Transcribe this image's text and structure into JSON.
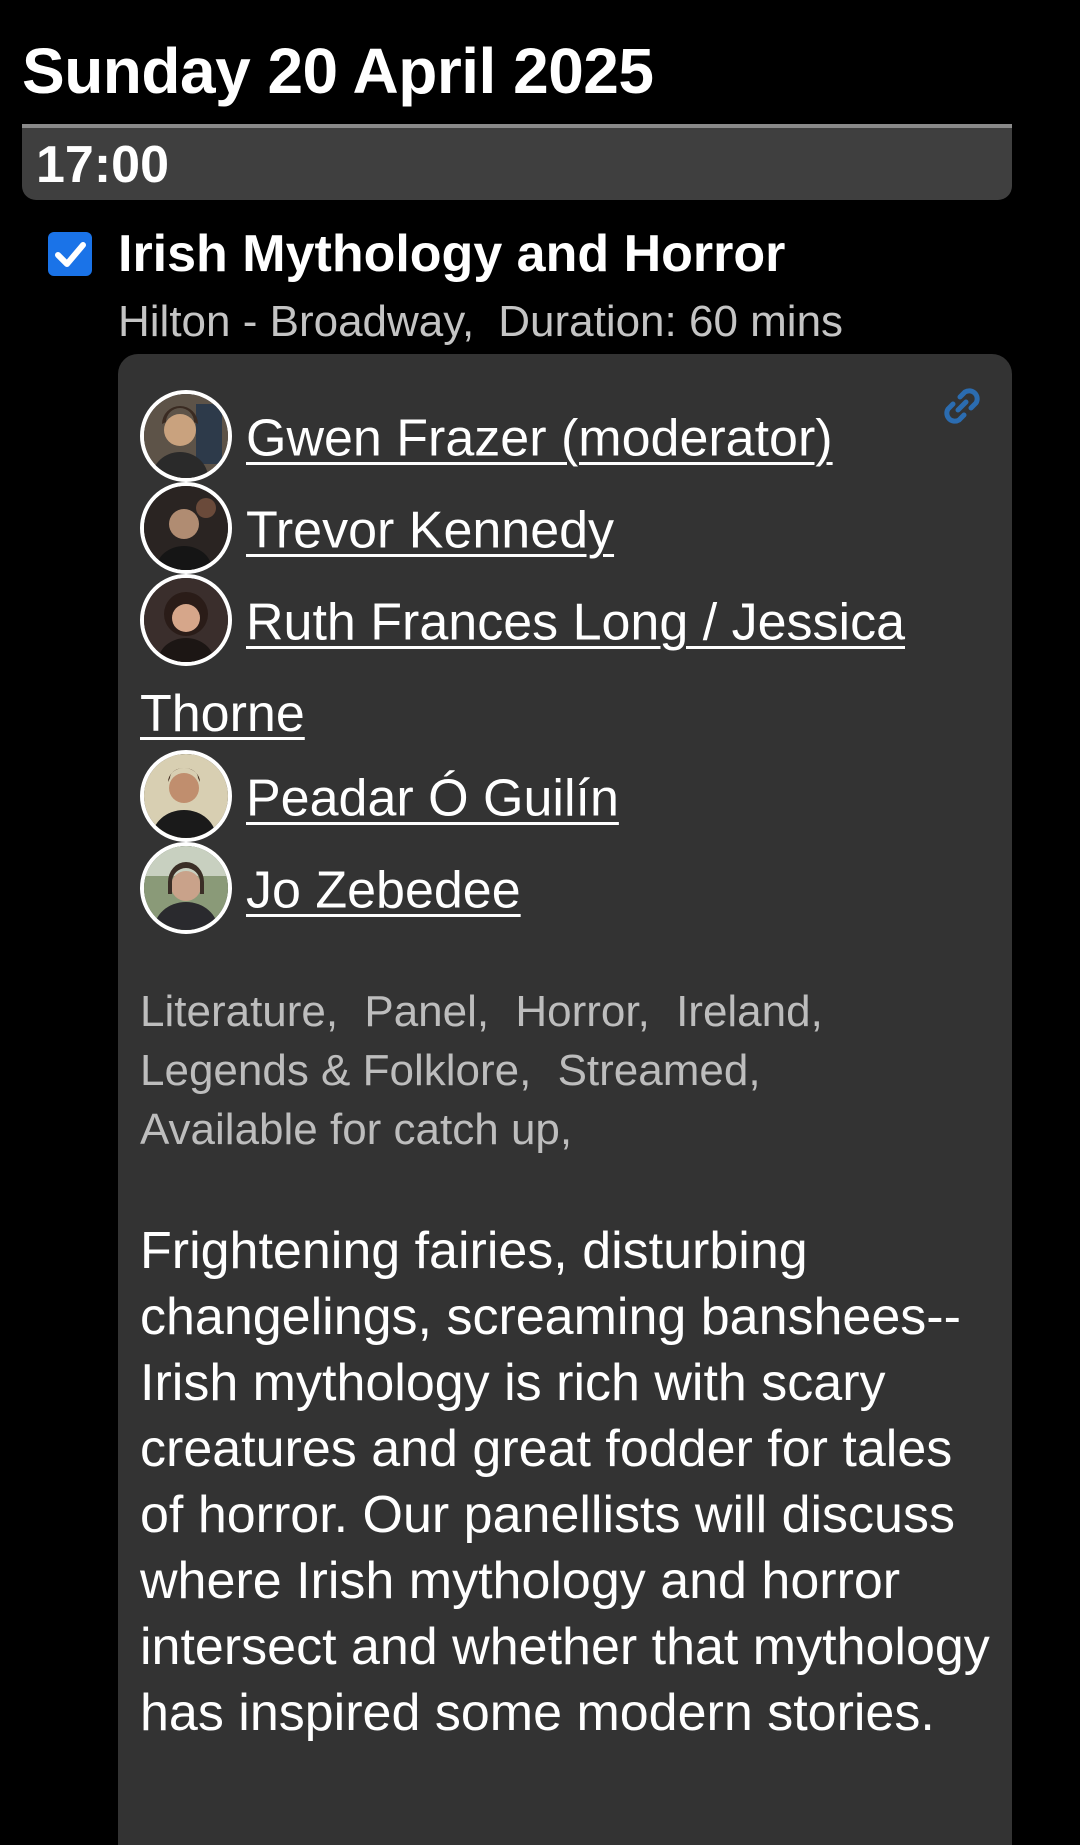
{
  "day_heading": "Sunday 20 April 2025",
  "time_slot": "17:00",
  "item": {
    "checked": true,
    "title": "Irish Mythology and Horror",
    "location": "Hilton - Broadway,",
    "duration": "Duration: 60 mins",
    "participants": [
      {
        "name": "Gwen Frazer (moderator)",
        "avatar_color": "#6b5a48"
      },
      {
        "name": "Trevor Kennedy",
        "avatar_color": "#3a3230"
      },
      {
        "name": "Ruth Frances Long / Jessica Thorne",
        "avatar_color": "#4a3a36"
      },
      {
        "name": "Peadar Ó Guilín",
        "avatar_color": "#c9bfa4"
      },
      {
        "name": "Jo Zebedee",
        "avatar_color": "#7a8468"
      }
    ],
    "tags": [
      "Literature,",
      "Panel,",
      "Horror,",
      "Ireland,",
      "Legends & Folklore,",
      "Streamed,",
      "Available for catch up,"
    ],
    "description": "Frightening fairies, disturbing changelings, screaming banshees--Irish mythology is rich with scary creatures and great fodder for tales of horror. Our panellists will discuss where Irish mythology and horror intersect and whether that mythology has inspired some modern stories.",
    "link_icon": "link-icon"
  },
  "colors": {
    "background": "#000000",
    "card": "#333333",
    "time_bar": "#3f3f3f",
    "checkbox": "#1a73e8",
    "link_icon": "#2b6cb0"
  }
}
